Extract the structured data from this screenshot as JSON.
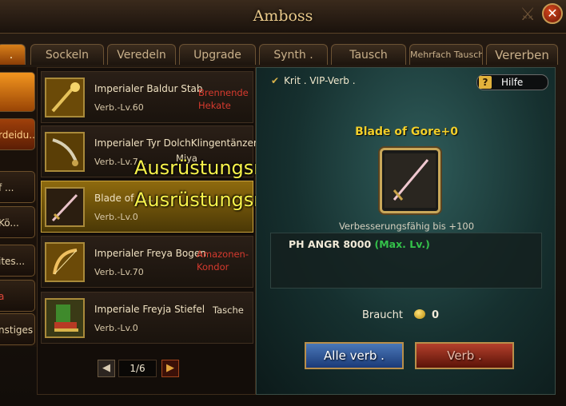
{
  "window": {
    "title": "Amboss"
  },
  "tabs": [
    {
      "label": "."
    },
    {
      "label": "Sockeln"
    },
    {
      "label": "Veredeln"
    },
    {
      "label": "Upgrade"
    },
    {
      "label": "Synth ."
    },
    {
      "label": "Tausch"
    },
    {
      "label": "Mehrfach Tausch"
    },
    {
      "label": "Vererben"
    }
  ],
  "sidebar": {
    "items": [
      {
        "label": ""
      },
      {
        "label": "rdeidu.."
      },
      {
        "label": "f ..."
      },
      {
        "label": "Kö..."
      },
      {
        "label": "ites..."
      },
      {
        "label": "a"
      },
      {
        "label": "nstiges"
      }
    ]
  },
  "items": [
    {
      "name": "Imperialer Baldur Stab",
      "level": "Verb.-Lv.60",
      "tag": "Brennende Hekate",
      "icon": "staff-icon"
    },
    {
      "name": "Imperialer Tyr DolchKlingentänzerin",
      "level": "Verb.-Lv.7...",
      "tag": "Miya",
      "icon": "dagger-icon"
    },
    {
      "name": "Blade of G...",
      "level": "Verb.-Lv.0",
      "tag": "",
      "icon": "sword-icon"
    },
    {
      "name": "Imperialer Freya Bogen",
      "level": "Verb.-Lv.70",
      "tag": "Amazonen-Kondor",
      "icon": "bow-icon"
    },
    {
      "name": "Imperiale Freyja Stiefel",
      "level": "Verb.-Lv.0",
      "tag": "Tasche",
      "icon": "boots-icon"
    }
  ],
  "overlays": [
    {
      "text": "Ausrüstungsmax. erreicht"
    },
    {
      "text": "Ausrüstungsmax. erreicht"
    }
  ],
  "pager": {
    "page": "1/6",
    "prev": "◀",
    "next": "▶"
  },
  "detail": {
    "vip": "Krit . VIP-Verb .",
    "help": "Hilfe",
    "help_icon": "?",
    "item_title": "Blade of Gore+0",
    "upgrade_hint": "Verbesserungsfähig bis +100",
    "stat_label": "PH ANGR 8000",
    "stat_note": "(Max. Lv.)",
    "need_label": "Braucht",
    "need_value": "0",
    "btn_all": "Alle verb .",
    "btn_single": "Verb ."
  },
  "colors": {
    "accent": "#f2cf2a",
    "stat_green": "#34c24a",
    "tag_red": "#d63a2e"
  }
}
